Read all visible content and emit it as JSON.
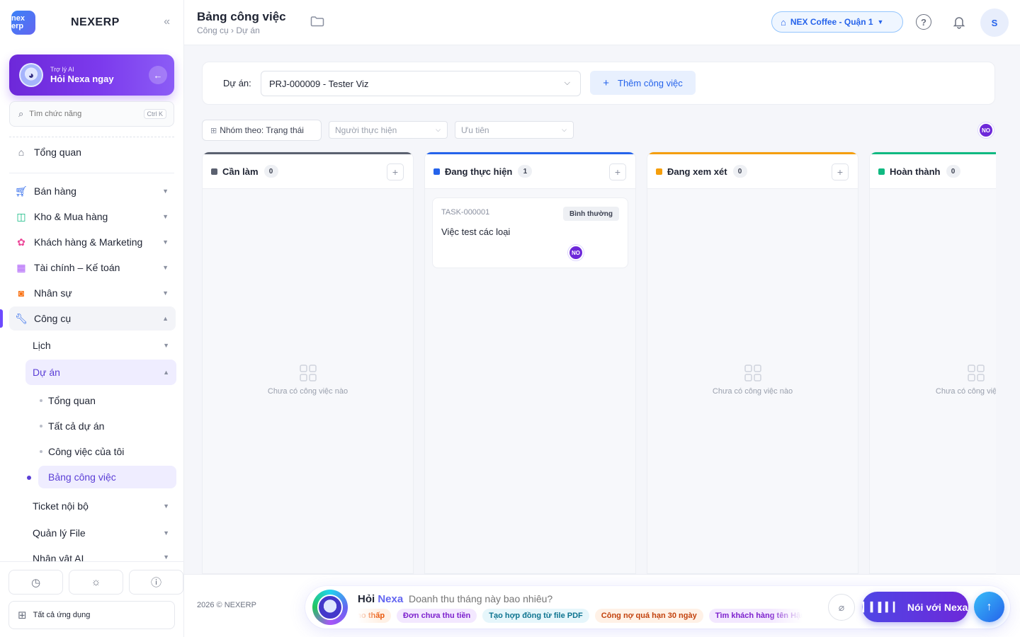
{
  "sidebar": {
    "brand_logo_text": "nex erp",
    "brand_name": "NEXERP",
    "ai": {
      "small": "Trợ lý AI",
      "big": "Hỏi Nexa ngay"
    },
    "search": {
      "placeholder": "Tìm chức năng",
      "shortcut": "Ctrl K"
    },
    "nav": [
      {
        "label": "Tổng quan"
      },
      {
        "label": "Bán hàng"
      },
      {
        "label": "Kho & Mua hàng"
      },
      {
        "label": "Khách hàng & Marketing"
      },
      {
        "label": "Tài chính – Kế toán"
      },
      {
        "label": "Nhân sự"
      },
      {
        "label": "Công cụ"
      }
    ],
    "tools_sub": [
      {
        "label": "Lịch"
      },
      {
        "label": "Dự án"
      },
      {
        "label": "Ticket nội bộ"
      },
      {
        "label": "Quản lý File"
      },
      {
        "label": "Nhân vật AI"
      }
    ],
    "project_sub": [
      {
        "label": "Tổng quan"
      },
      {
        "label": "Tất cả dự án"
      },
      {
        "label": "Công việc của tôi"
      },
      {
        "label": "Bảng công việc"
      }
    ],
    "all_apps": "Tất cả ứng dụng"
  },
  "header": {
    "title": "Bảng công việc",
    "breadcrumb": "Công cụ › Dự án",
    "store": "NEX Coffee - Quận 1",
    "user_initial": "S"
  },
  "project": {
    "label": "Dự án:",
    "selected": "PRJ-000009 - Tester Viz",
    "add_label": "Thêm công việc"
  },
  "filters": {
    "group": "Nhóm theo: Trạng thái",
    "assignee": "Người thực hiện",
    "priority": "Ưu tiên",
    "member_badge": "NO"
  },
  "columns": [
    {
      "title": "Cần làm",
      "count": "0",
      "color": "#5b6170",
      "empty": "Chưa có công việc nào"
    },
    {
      "title": "Đang thực hiện",
      "count": "1",
      "color": "#2563eb"
    },
    {
      "title": "Đang xem xét",
      "count": "0",
      "color": "#f59e0b",
      "empty": "Chưa có công việc nào"
    },
    {
      "title": "Hoàn thành",
      "count": "0",
      "color": "#10b981",
      "empty": "Chưa có công việc nào"
    }
  ],
  "task": {
    "id": "TASK-000001",
    "priority": "Bình thường",
    "name": "Việc test các loại",
    "assignee": "NO"
  },
  "footer": {
    "copyright": "2026 © NEXERP",
    "ask_title_a": "Hỏi",
    "ask_title_b": "Nexa",
    "ask_placeholder": "Doanh thu tháng này bao nhiêu?",
    "chips": [
      "Tồn kho thấp",
      "Đơn chưa thu tiền",
      "Tạo hợp đồng từ file PDF",
      "Công nợ quá hạn 30 ngày",
      "Tìm khách hàng tên Hậu"
    ],
    "voice_label": "Nói với Nexa"
  },
  "colors": {
    "primary": "#6d28d9",
    "accent_blue": "#2563eb"
  }
}
